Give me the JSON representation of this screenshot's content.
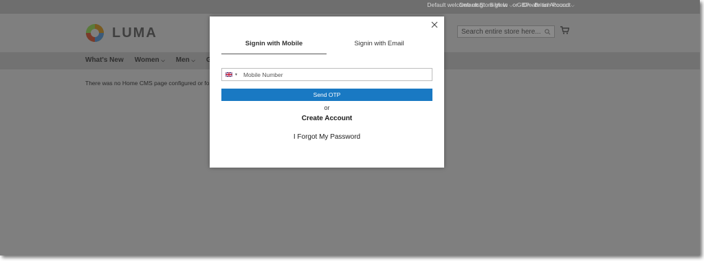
{
  "topbar": {
    "welcome": "Default welcome msg!",
    "sign_in": "Sign In",
    "or": "or",
    "create_account": "Create an Account",
    "store_view": "Default Store View",
    "currency": "GBP - British Pound"
  },
  "header": {
    "logo_text": "LUMA",
    "search_placeholder": "Search entire store here..."
  },
  "nav": {
    "items": [
      {
        "label": "What's New"
      },
      {
        "label": "Women"
      },
      {
        "label": "Men"
      },
      {
        "label": "Gear"
      }
    ]
  },
  "main": {
    "message": "There was no Home CMS page configured or found."
  },
  "modal": {
    "tabs": [
      {
        "label": "Signin with Mobile",
        "active": true
      },
      {
        "label": "Signin with Email",
        "active": false
      }
    ],
    "phone_placeholder": "Mobile Number",
    "send_otp": "Send OTP",
    "or": "or",
    "create_account": "Create Account",
    "forgot_password": "I Forgot My Password"
  },
  "colors": {
    "accent": "#1979c3",
    "overlay_topbar": "#6e6e6e",
    "overlay_page": "#7f7f7f"
  }
}
